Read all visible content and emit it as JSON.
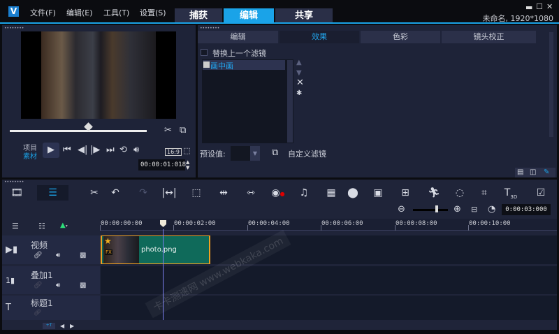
{
  "menu": {
    "items": [
      "文件(F)",
      "编辑(E)",
      "工具(T)",
      "设置(S)"
    ]
  },
  "main_tabs": [
    {
      "label": "捕获"
    },
    {
      "label": "编辑",
      "active": true
    },
    {
      "label": "共享"
    }
  ],
  "project_info": "未命名, 1920*1080",
  "player": {
    "project_label": "项目",
    "clip_label": "素材",
    "timecode": "00:00:01:018",
    "aspect_ratio": "16:9",
    "scrub_progress": 0.57
  },
  "options_panel": {
    "tabs": [
      {
        "label": "编辑"
      },
      {
        "label": "效果",
        "active": true
      },
      {
        "label": "色彩"
      },
      {
        "label": "镜头校正"
      }
    ],
    "replace_last_filter_label": "替换上一个滤镜",
    "replace_last_filter_checked": false,
    "filters": [
      {
        "label": "画中画",
        "selected": true
      }
    ],
    "preset_label": "预设值:",
    "preset_value": "",
    "custom_filter_label": "自定义滤镜"
  },
  "timeline": {
    "zoom_timecode": "0:00:03:000",
    "ruler": [
      "00:00:00:00",
      "00:00:02:00",
      "00:00:04:00",
      "00:00:06:00",
      "00:00:08:00",
      "00:00:10:00"
    ],
    "tracks": [
      {
        "name": "视频",
        "clip": "photo.png"
      },
      {
        "name": "叠加1"
      },
      {
        "name": "标题1"
      }
    ]
  },
  "watermark": "卡卡测速网 www.webkaka.com",
  "colors": {
    "accent": "#1aa3e8",
    "clip_green": "#0f6a5a",
    "clip_border": "#f0a020",
    "panel": "#1e2338"
  }
}
